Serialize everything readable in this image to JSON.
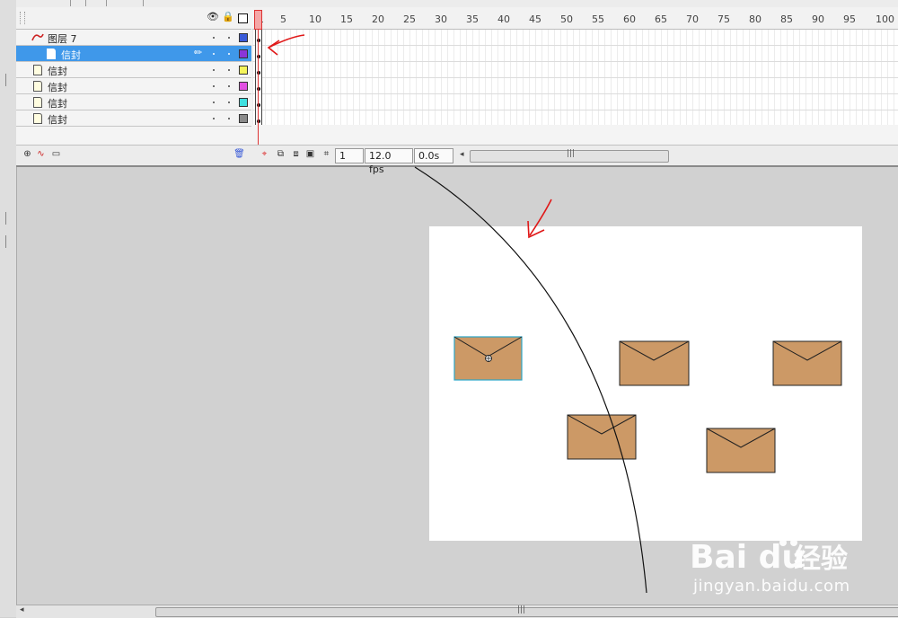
{
  "timeline": {
    "layers": [
      {
        "name": "图层 7",
        "type": "motion-guide",
        "color": "#3a5bd8",
        "selected": false
      },
      {
        "name": "信封",
        "type": "guided",
        "color": "#8a35d8",
        "selected": true
      },
      {
        "name": "信封",
        "type": "normal",
        "color": "#f4f45a",
        "selected": false
      },
      {
        "name": "信封",
        "type": "normal",
        "color": "#e250e2",
        "selected": false
      },
      {
        "name": "信封",
        "type": "normal",
        "color": "#3ee0e0",
        "selected": false
      },
      {
        "name": "信封",
        "type": "normal",
        "color": "#8a8a8a",
        "selected": false
      }
    ],
    "ruler": [
      "1",
      "5",
      "10",
      "15",
      "20",
      "25",
      "30",
      "35",
      "40",
      "45",
      "50",
      "55",
      "60",
      "65",
      "70",
      "75",
      "80",
      "85",
      "90",
      "95",
      "100"
    ],
    "current_frame": "1",
    "fps": "12.0 fps",
    "elapsed": "0.0s",
    "scroll_grip": "|||"
  },
  "stage": {
    "background": "#ffffff",
    "envelope_color": "#cc9966",
    "guide_path_color": "#111111",
    "annotation_color": "#e01818"
  },
  "icons": {
    "eye": "eye-icon",
    "lock": "lock-icon",
    "outline": "outline-icon",
    "pencil": "pencil-icon",
    "add_layer": "add-layer-icon",
    "add_guide": "add-motion-guide-icon",
    "add_folder": "add-folder-icon",
    "trash": "trash-icon"
  },
  "watermark": {
    "logo_text": "Bai du 经验",
    "url": "jingyan.baidu.com"
  },
  "bottom_scroll_grip": "|||"
}
